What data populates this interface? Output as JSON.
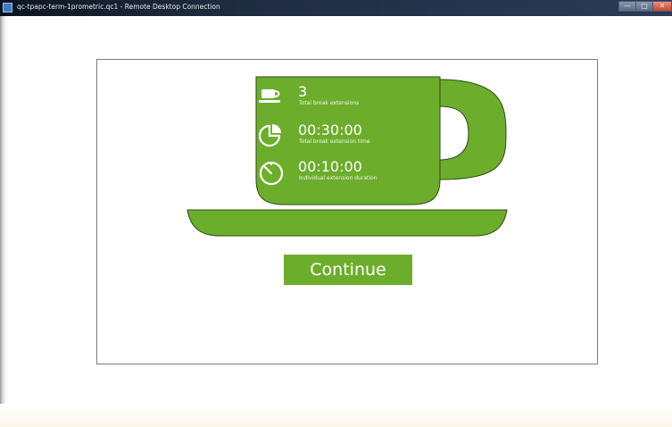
{
  "window": {
    "title": "qc-tpapc-term-1prometric.qc1 - Remote Desktop Connection",
    "app_icon": "remote-desktop-icon",
    "controls": {
      "minimize_glyph": "—",
      "maximize_glyph": "□",
      "close_glyph": "✕"
    }
  },
  "break_info": {
    "stats": [
      {
        "icon": "coffee-cup-icon",
        "value": "3",
        "label": "Total break extensions"
      },
      {
        "icon": "pie-chart-icon",
        "value": "00:30:00",
        "label": "Total break extension time"
      },
      {
        "icon": "stopwatch-icon",
        "value": "00:10:00",
        "label": "Individual extension duration"
      }
    ],
    "continue_label": "Continue"
  },
  "colors": {
    "cup_green": "#6cae2c",
    "cup_outline": "#2f4a18",
    "button_green": "#6cae2c",
    "dialog_border": "#7d7d7d",
    "titlebar_dark": "#0d1420"
  }
}
